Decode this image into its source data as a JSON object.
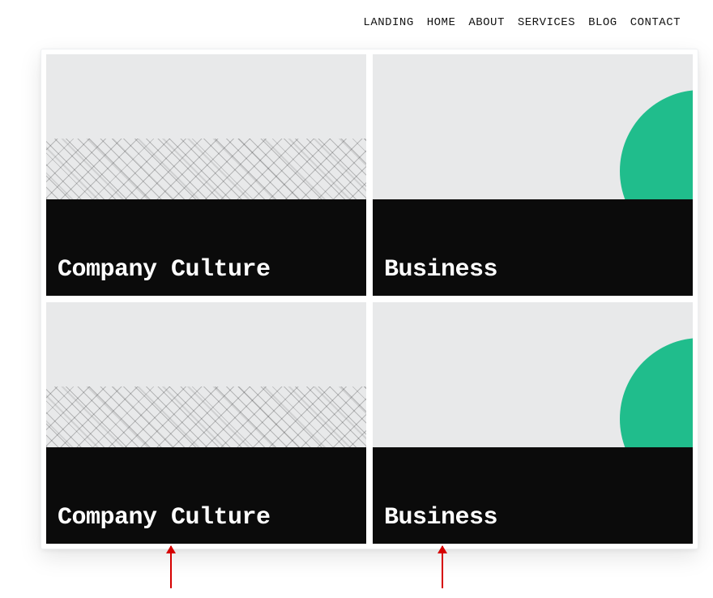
{
  "nav": {
    "items": [
      {
        "label": "LANDING"
      },
      {
        "label": "HOME"
      },
      {
        "label": "ABOUT"
      },
      {
        "label": "SERVICES"
      },
      {
        "label": "BLOG"
      },
      {
        "label": "CONTACT"
      }
    ]
  },
  "cards": {
    "r0c0": {
      "title": "Company Culture"
    },
    "r0c1": {
      "title": "Business"
    },
    "r1c0": {
      "title": "Company Culture"
    },
    "r1c1": {
      "title": "Business"
    }
  },
  "colors": {
    "accent_green": "#20bd8c",
    "card_footer": "#0b0b0b",
    "card_bg": "#e8e9ea",
    "annotation_red": "#d60000"
  }
}
